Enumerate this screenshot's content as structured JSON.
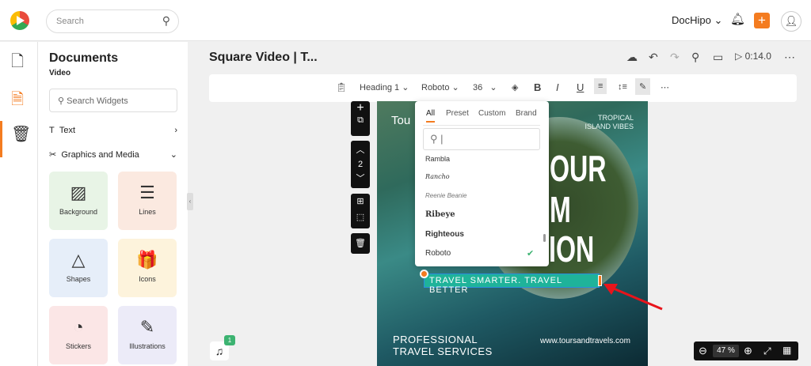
{
  "header": {
    "search_placeholder": "Search",
    "brand": "DocHipo ⌄"
  },
  "panel": {
    "title": "Documents",
    "subtitle": "Video",
    "search_placeholder": "Search Widgets",
    "text_label": "Text",
    "graphics_label": "Graphics and Media",
    "tiles": [
      {
        "label": "Background",
        "glyph": "▨",
        "color": "#e8f4e6"
      },
      {
        "label": "Lines",
        "glyph": "☰",
        "color": "#fbe9e0"
      },
      {
        "label": "Shapes",
        "glyph": "△",
        "color": "#e6eef9"
      },
      {
        "label": "Icons",
        "glyph": "🎁",
        "color": "#fdf3dc"
      },
      {
        "label": "Stickers",
        "glyph": "◔",
        "color": "#fbe6e6"
      },
      {
        "label": "Illustrations",
        "glyph": "✎",
        "color": "#ecebf8"
      }
    ]
  },
  "doc": {
    "title": "Square Video | T...",
    "duration": "0:14.0"
  },
  "format": {
    "style": "Heading 1",
    "font": "Roboto",
    "size": "36"
  },
  "canvas": {
    "tou": "Tou",
    "tropical": "TROPICAL",
    "island": "ISLAND VIBES",
    "big1": "OUR",
    "big2": "M",
    "big3": "ION",
    "tagline": "TRAVEL SMARTER. TRAVEL BETTER",
    "professional": "PROFESSIONAL",
    "services": "TRAVEL SERVICES",
    "url": "www.toursandtravels.com"
  },
  "controls": {
    "page": "2"
  },
  "dropdown": {
    "tabs": [
      "All",
      "Preset",
      "Custom",
      "Brand"
    ],
    "fonts": [
      "Rambla",
      "Rancho",
      "Reenie Beanie",
      "Ribeye",
      "Righteous",
      "Roboto"
    ]
  },
  "zoom": {
    "value": "47",
    "unit": "%"
  },
  "audio": {
    "badge": "1"
  }
}
